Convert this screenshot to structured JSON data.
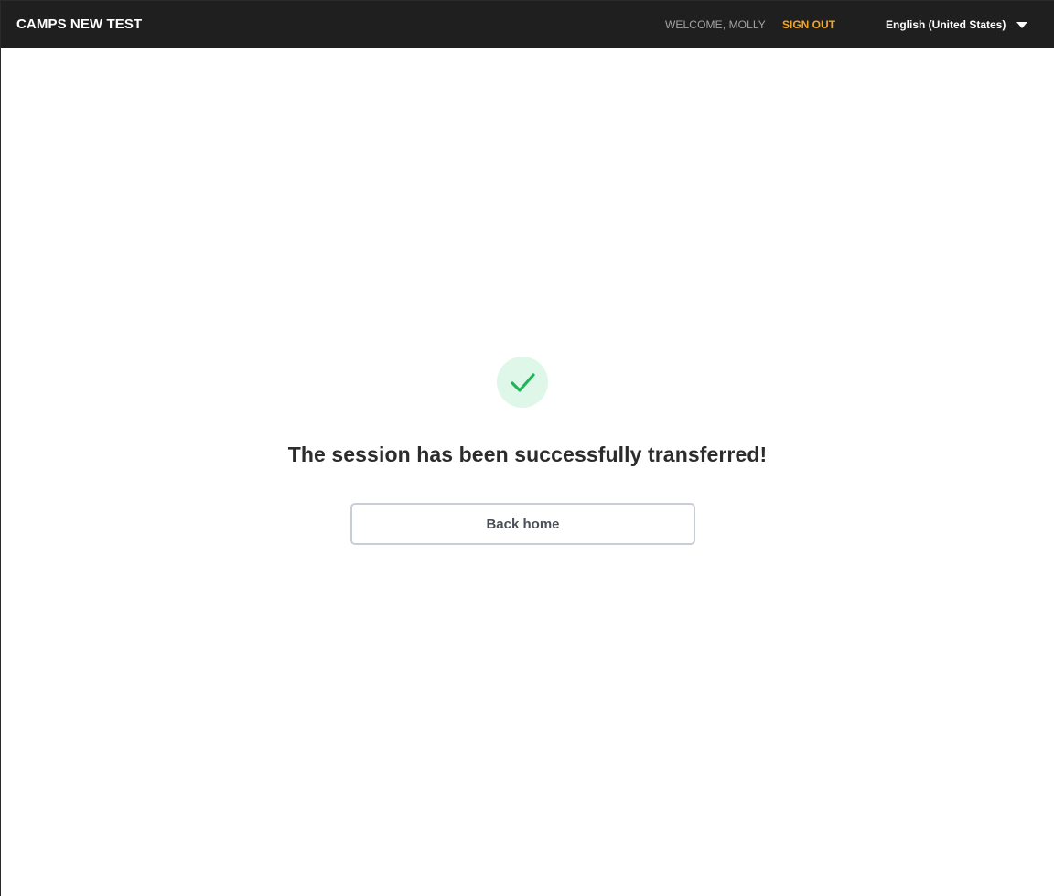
{
  "header": {
    "brand": "CAMPS NEW TEST",
    "welcome": "WELCOME, MOLLY",
    "sign_out": "SIGN OUT",
    "language": "English (United States)"
  },
  "main": {
    "message": "The session has been successfully transferred!",
    "back_button": "Back home",
    "status_icon": "check-icon"
  },
  "colors": {
    "topbar": "#1f1f1f",
    "accent": "#f2a623",
    "success": "#22b45a",
    "success_bg": "#dff7e8"
  }
}
